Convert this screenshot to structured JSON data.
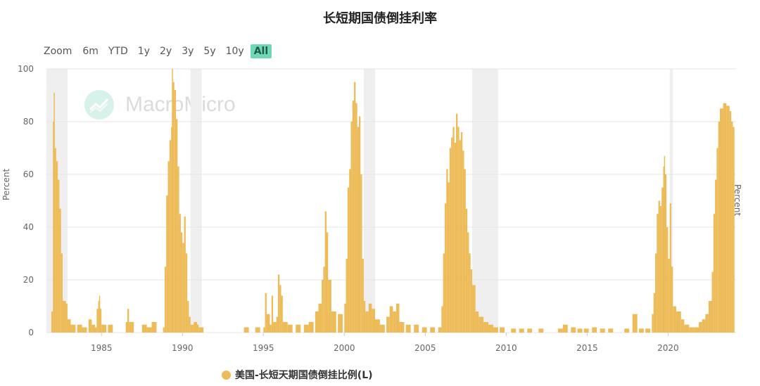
{
  "title": "长短期国债倒挂利率",
  "zoom": {
    "label": "Zoom",
    "buttons": [
      "6m",
      "YTD",
      "1y",
      "2y",
      "3y",
      "5y",
      "10y",
      "All"
    ],
    "active": "All"
  },
  "watermark": "MacroMicro",
  "axes": {
    "left_title": "Percent",
    "right_title": "Percent",
    "y_ticks": [
      "0",
      "20",
      "40",
      "60",
      "80",
      "100"
    ],
    "x_ticks": [
      "1985",
      "1990",
      "1995",
      "2000",
      "2005",
      "2010",
      "2015",
      "2020"
    ]
  },
  "legend": {
    "label": "美国-长短天期国债倒挂比例(L)"
  },
  "colors": {
    "series": "#edbb57",
    "recession": "#efefef",
    "grid": "#e6e6e6",
    "active_zoom": "#6ed7b7"
  },
  "chart_data": {
    "type": "bar",
    "title": "长短期国债倒挂利率",
    "ylabel": "Percent",
    "ylim": [
      0,
      100
    ],
    "xlim": [
      1981.6,
      2024.2
    ],
    "recessions": [
      [
        1981.6,
        1982.9
      ],
      [
        1990.5,
        1991.2
      ],
      [
        2001.2,
        2001.9
      ],
      [
        2007.9,
        2009.5
      ],
      [
        2020.1,
        2020.3
      ]
    ],
    "series": [
      {
        "name": "美国-长短天期国债倒挂比例(L)",
        "points": [
          [
            1981.9,
            8
          ],
          [
            1982.0,
            80
          ],
          [
            1982.05,
            91
          ],
          [
            1982.1,
            70
          ],
          [
            1982.2,
            65
          ],
          [
            1982.3,
            58
          ],
          [
            1982.4,
            47
          ],
          [
            1982.5,
            30
          ],
          [
            1982.6,
            12
          ],
          [
            1982.8,
            11
          ],
          [
            1982.9,
            5
          ],
          [
            1983.1,
            3
          ],
          [
            1983.5,
            3
          ],
          [
            1983.8,
            2
          ],
          [
            1984.2,
            5
          ],
          [
            1984.4,
            3
          ],
          [
            1984.6,
            2
          ],
          [
            1984.7,
            9
          ],
          [
            1984.8,
            12
          ],
          [
            1984.85,
            14
          ],
          [
            1984.9,
            9
          ],
          [
            1985.0,
            3
          ],
          [
            1985.4,
            3
          ],
          [
            1986.5,
            4
          ],
          [
            1986.6,
            9
          ],
          [
            1986.7,
            4
          ],
          [
            1987.5,
            3
          ],
          [
            1987.8,
            2
          ],
          [
            1988.1,
            4
          ],
          [
            1988.8,
            2
          ],
          [
            1988.9,
            25
          ],
          [
            1989.0,
            52
          ],
          [
            1989.1,
            65
          ],
          [
            1989.2,
            73
          ],
          [
            1989.3,
            78
          ],
          [
            1989.35,
            100
          ],
          [
            1989.4,
            95
          ],
          [
            1989.5,
            92
          ],
          [
            1989.6,
            81
          ],
          [
            1989.7,
            63
          ],
          [
            1989.8,
            45
          ],
          [
            1989.9,
            38
          ],
          [
            1990.0,
            34
          ],
          [
            1990.1,
            44
          ],
          [
            1990.2,
            30
          ],
          [
            1990.3,
            12
          ],
          [
            1990.4,
            6
          ],
          [
            1990.5,
            3
          ],
          [
            1990.7,
            4
          ],
          [
            1990.9,
            3
          ],
          [
            1991.0,
            2
          ],
          [
            1993.8,
            2
          ],
          [
            1994.5,
            2
          ],
          [
            1995.0,
            2
          ],
          [
            1995.1,
            15
          ],
          [
            1995.2,
            7
          ],
          [
            1995.4,
            3
          ],
          [
            1995.5,
            14
          ],
          [
            1995.6,
            4
          ],
          [
            1995.8,
            6
          ],
          [
            1995.9,
            22
          ],
          [
            1996.0,
            18
          ],
          [
            1996.1,
            14
          ],
          [
            1996.2,
            4
          ],
          [
            1996.5,
            3
          ],
          [
            1997.0,
            3
          ],
          [
            1997.5,
            3
          ],
          [
            1997.8,
            4
          ],
          [
            1998.2,
            8
          ],
          [
            1998.4,
            11
          ],
          [
            1998.6,
            20
          ],
          [
            1998.7,
            25
          ],
          [
            1998.8,
            46
          ],
          [
            1998.9,
            38
          ],
          [
            1999.0,
            20
          ],
          [
            1999.2,
            8
          ],
          [
            1999.6,
            7
          ],
          [
            2000.0,
            11
          ],
          [
            2000.1,
            28
          ],
          [
            2000.2,
            55
          ],
          [
            2000.3,
            62
          ],
          [
            2000.4,
            80
          ],
          [
            2000.5,
            88
          ],
          [
            2000.6,
            95
          ],
          [
            2000.7,
            87
          ],
          [
            2000.8,
            78
          ],
          [
            2000.9,
            82
          ],
          [
            2001.0,
            60
          ],
          [
            2001.1,
            28
          ],
          [
            2001.2,
            12
          ],
          [
            2001.3,
            8
          ],
          [
            2001.5,
            11
          ],
          [
            2001.7,
            9
          ],
          [
            2001.9,
            5
          ],
          [
            2002.2,
            3
          ],
          [
            2002.6,
            6
          ],
          [
            2002.8,
            10
          ],
          [
            2003.0,
            8
          ],
          [
            2003.2,
            11
          ],
          [
            2003.4,
            4
          ],
          [
            2003.8,
            3
          ],
          [
            2004.3,
            3
          ],
          [
            2004.8,
            2
          ],
          [
            2005.3,
            2
          ],
          [
            2005.8,
            2
          ],
          [
            2006.0,
            10
          ],
          [
            2006.1,
            30
          ],
          [
            2006.2,
            49
          ],
          [
            2006.3,
            62
          ],
          [
            2006.4,
            57
          ],
          [
            2006.5,
            70
          ],
          [
            2006.6,
            74
          ],
          [
            2006.7,
            78
          ],
          [
            2006.8,
            72
          ],
          [
            2006.9,
            83
          ],
          [
            2007.0,
            78
          ],
          [
            2007.1,
            73
          ],
          [
            2007.2,
            76
          ],
          [
            2007.3,
            69
          ],
          [
            2007.4,
            62
          ],
          [
            2007.5,
            47
          ],
          [
            2007.6,
            38
          ],
          [
            2007.7,
            30
          ],
          [
            2007.8,
            24
          ],
          [
            2007.9,
            18
          ],
          [
            2008.1,
            8
          ],
          [
            2008.3,
            6
          ],
          [
            2008.6,
            4
          ],
          [
            2008.9,
            3
          ],
          [
            2009.2,
            2
          ],
          [
            2009.6,
            2
          ],
          [
            2010.3,
            1.5
          ],
          [
            2010.8,
            1.5
          ],
          [
            2011.3,
            1.5
          ],
          [
            2012.0,
            1.5
          ],
          [
            2013.2,
            1.5
          ],
          [
            2013.5,
            3
          ],
          [
            2014.0,
            2
          ],
          [
            2014.4,
            1.5
          ],
          [
            2014.8,
            1.5
          ],
          [
            2015.3,
            2
          ],
          [
            2015.8,
            1.5
          ],
          [
            2016.3,
            1.5
          ],
          [
            2017.3,
            1.5
          ],
          [
            2017.8,
            7
          ],
          [
            2018.2,
            1.5
          ],
          [
            2018.6,
            1.5
          ],
          [
            2019.0,
            7
          ],
          [
            2019.1,
            15
          ],
          [
            2019.2,
            30
          ],
          [
            2019.3,
            45
          ],
          [
            2019.4,
            50
          ],
          [
            2019.5,
            48
          ],
          [
            2019.6,
            55
          ],
          [
            2019.7,
            63
          ],
          [
            2019.75,
            67
          ],
          [
            2019.8,
            60
          ],
          [
            2019.9,
            40
          ],
          [
            2020.0,
            28
          ],
          [
            2020.1,
            49
          ],
          [
            2020.2,
            25
          ],
          [
            2020.3,
            10
          ],
          [
            2020.5,
            8
          ],
          [
            2020.8,
            5
          ],
          [
            2021.0,
            3
          ],
          [
            2021.3,
            2
          ],
          [
            2021.6,
            2
          ],
          [
            2021.9,
            4
          ],
          [
            2022.1,
            5
          ],
          [
            2022.3,
            7
          ],
          [
            2022.5,
            12
          ],
          [
            2022.7,
            23
          ],
          [
            2022.8,
            45
          ],
          [
            2022.9,
            58
          ],
          [
            2023.0,
            70
          ],
          [
            2023.1,
            80
          ],
          [
            2023.2,
            85
          ],
          [
            2023.4,
            87
          ],
          [
            2023.6,
            86
          ],
          [
            2023.8,
            84
          ],
          [
            2023.9,
            80
          ],
          [
            2024.0,
            78
          ]
        ]
      }
    ]
  }
}
